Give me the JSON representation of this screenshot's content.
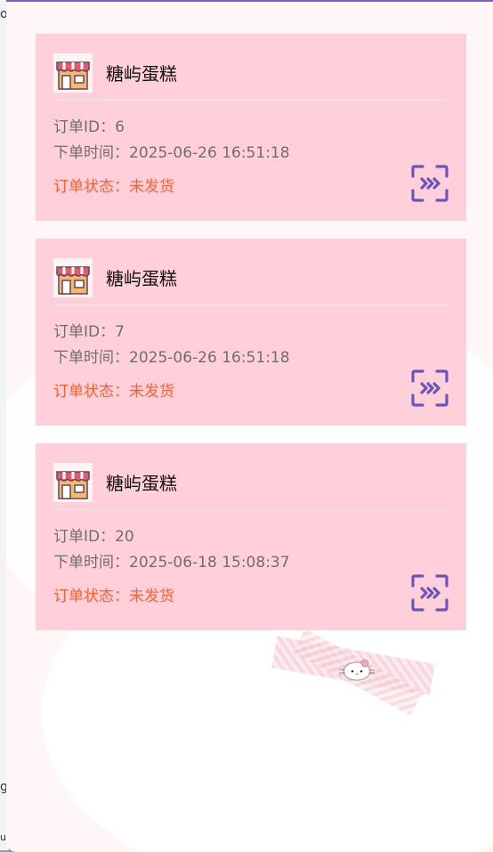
{
  "behind_window": {
    "fragments": [
      "o",
      "g",
      "u"
    ]
  },
  "orders": [
    {
      "shop_name": "糖屿蛋糕",
      "order_id_label": "订单ID：",
      "order_id": "6",
      "time_label": "下单时间：",
      "time": "2025-06-26 16:51:18",
      "status_label": "订单状态：",
      "status": "未发货",
      "action_icon": "scan-forward-icon"
    },
    {
      "shop_name": "糖屿蛋糕",
      "order_id_label": "订单ID：",
      "order_id": "7",
      "time_label": "下单时间：",
      "time": "2025-06-26 16:51:18",
      "status_label": "订单状态：",
      "status": "未发货",
      "action_icon": "scan-forward-icon"
    },
    {
      "shop_name": "糖屿蛋糕",
      "order_id_label": "订单ID：",
      "order_id": "20",
      "time_label": "下单时间：",
      "time": "2025-06-18 15:08:37",
      "status_label": "订单状态：",
      "status": "未发货",
      "action_icon": "scan-forward-icon"
    }
  ],
  "colors": {
    "card_bg": "#ffd0da",
    "status": "#ff5f2e",
    "accent": "#6a55b8",
    "text_muted": "#6e6e6e"
  }
}
